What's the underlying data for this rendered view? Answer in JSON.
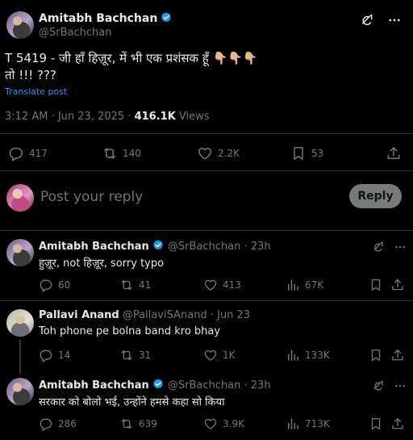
{
  "post": {
    "author_name": "Amitabh Bachchan",
    "author_handle": "@SrBachchan",
    "text_line1": "T 5419 - जी हाँ हिज़ूर, में भी एक प्रशंसक हूँ 👇🏼👇🏼👇🏼",
    "text_line2": "तो !!! ???",
    "translate": "Translate post",
    "time": "3:12 AM · Jun 23, 2025 · ",
    "views_count": "416.1K",
    "views_label": " Views",
    "stats": {
      "replies": "417",
      "reposts": "140",
      "likes": "2.2K",
      "bookmarks": "53"
    }
  },
  "composer": {
    "placeholder": "Post your reply",
    "button": "Reply"
  },
  "replies": [
    {
      "name": "Amitabh Bachchan",
      "meta": "@SrBachchan · 23h",
      "text": "हुज़ूर, not हिज़ूर, sorry typo",
      "replies": "60",
      "reposts": "41",
      "likes": "413",
      "views": "67K"
    },
    {
      "name": "Pallavi Anand",
      "meta": "@PallaviSAnand · Jun 23",
      "text": "Toh phone pe bolna band kro bhay",
      "replies": "14",
      "reposts": "31",
      "likes": "1K",
      "views": "133K"
    },
    {
      "name": "Amitabh Bachchan",
      "meta": "@SrBachchan · 23h",
      "text": "सरकार को बोलो भई, उन्होंने हमसे कहा सो किया",
      "replies": "286",
      "reposts": "639",
      "likes": "3.9K",
      "views": "713K"
    }
  ],
  "colors": {
    "accent": "#1d9bf0",
    "muted": "#71767b",
    "bg": "#000000"
  }
}
